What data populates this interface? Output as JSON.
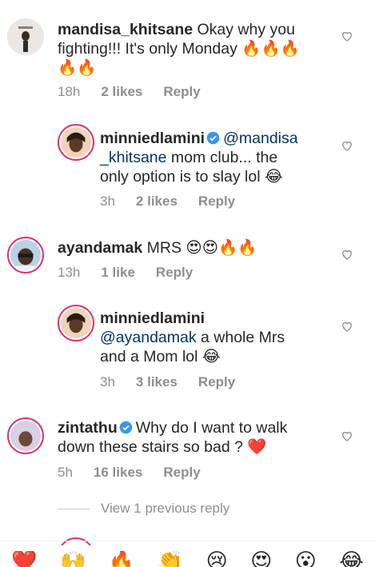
{
  "comments": [
    {
      "username": "mandisa_khitsane",
      "verified": false,
      "text_line1": " Okay why you",
      "text_line2": "fighting!!! It's only Monday 🔥🔥🔥",
      "text_line3": "🔥🔥",
      "time": "18h",
      "likes": "2 likes",
      "reply": "Reply"
    },
    {
      "username": "minniedlamini",
      "verified": true,
      "mention": "@mandisa",
      "line2_mention": "_khitsane",
      "line2_text": " mom club... the",
      "line3_text": "only option is to slay lol 😂",
      "time": "3h",
      "likes": "2 likes",
      "reply": "Reply"
    },
    {
      "username": "ayandamak",
      "verified": false,
      "text_line1": " MRS 😍😍🔥🔥",
      "time": "13h",
      "likes": "1 like",
      "reply": "Reply"
    },
    {
      "username": "minniedlamini",
      "verified": false,
      "mention": "@ayandamak",
      "line2_text": " a whole Mrs",
      "line3_text": "and a Mom lol 😂",
      "time": "3h",
      "likes": "3 likes",
      "reply": "Reply"
    },
    {
      "username": "zintathu",
      "verified": true,
      "text_line1": "Why do I want to walk",
      "text_line2": "down these stairs so bad ? ❤️",
      "time": "5h",
      "likes": "16 likes",
      "reply": "Reply"
    }
  ],
  "view_replies": "View 1 previous reply",
  "emoji_bar": [
    "❤️",
    "🙌",
    "🔥",
    "👏",
    "😢",
    "😍",
    "😮",
    "😂"
  ],
  "colors": {
    "mention": "#003569",
    "meta": "#8e8e8e",
    "heart": "#ed4956",
    "verified": "#3897f0"
  }
}
